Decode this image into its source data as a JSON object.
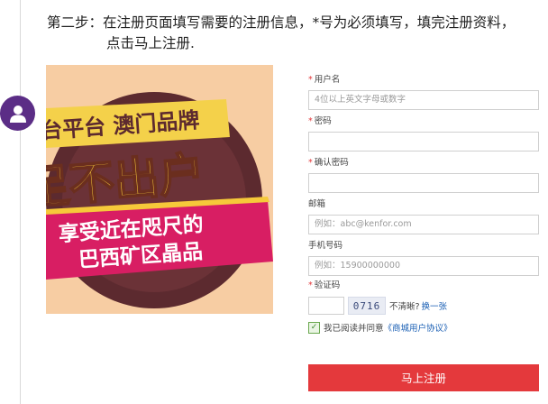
{
  "instruction": {
    "line1": "第二步：在注册页面填写需要的注册信息，*号为必须填写，填完注册资料，",
    "line2": "点击马上注册."
  },
  "promo": {
    "banner_top": "台平台 澳门品牌",
    "headline": "足不出户",
    "subline1": "享受近在咫尺的",
    "subline2": "巴西矿区晶品"
  },
  "form": {
    "required_mark": "*",
    "username": {
      "label": "用户名",
      "placeholder": "4位以上英文字母或数字"
    },
    "password": {
      "label": "密码"
    },
    "confirm_password": {
      "label": "确认密码"
    },
    "email": {
      "label": "邮箱",
      "placeholder": "例如：abc@kenfor.com"
    },
    "phone": {
      "label": "手机号码",
      "placeholder": "例如：15900000000"
    },
    "captcha": {
      "label": "验证码",
      "code": "0716",
      "hint": "不清晰?",
      "refresh": "换一张"
    },
    "agree": {
      "checked": true,
      "check_mark": "✓",
      "text": "我已阅读并同意",
      "link": "《商城用户协议》"
    },
    "submit": "马上注册"
  },
  "colors": {
    "accent": "#e4393c",
    "avatar": "#5b2d86",
    "link": "#1a5fb4"
  }
}
